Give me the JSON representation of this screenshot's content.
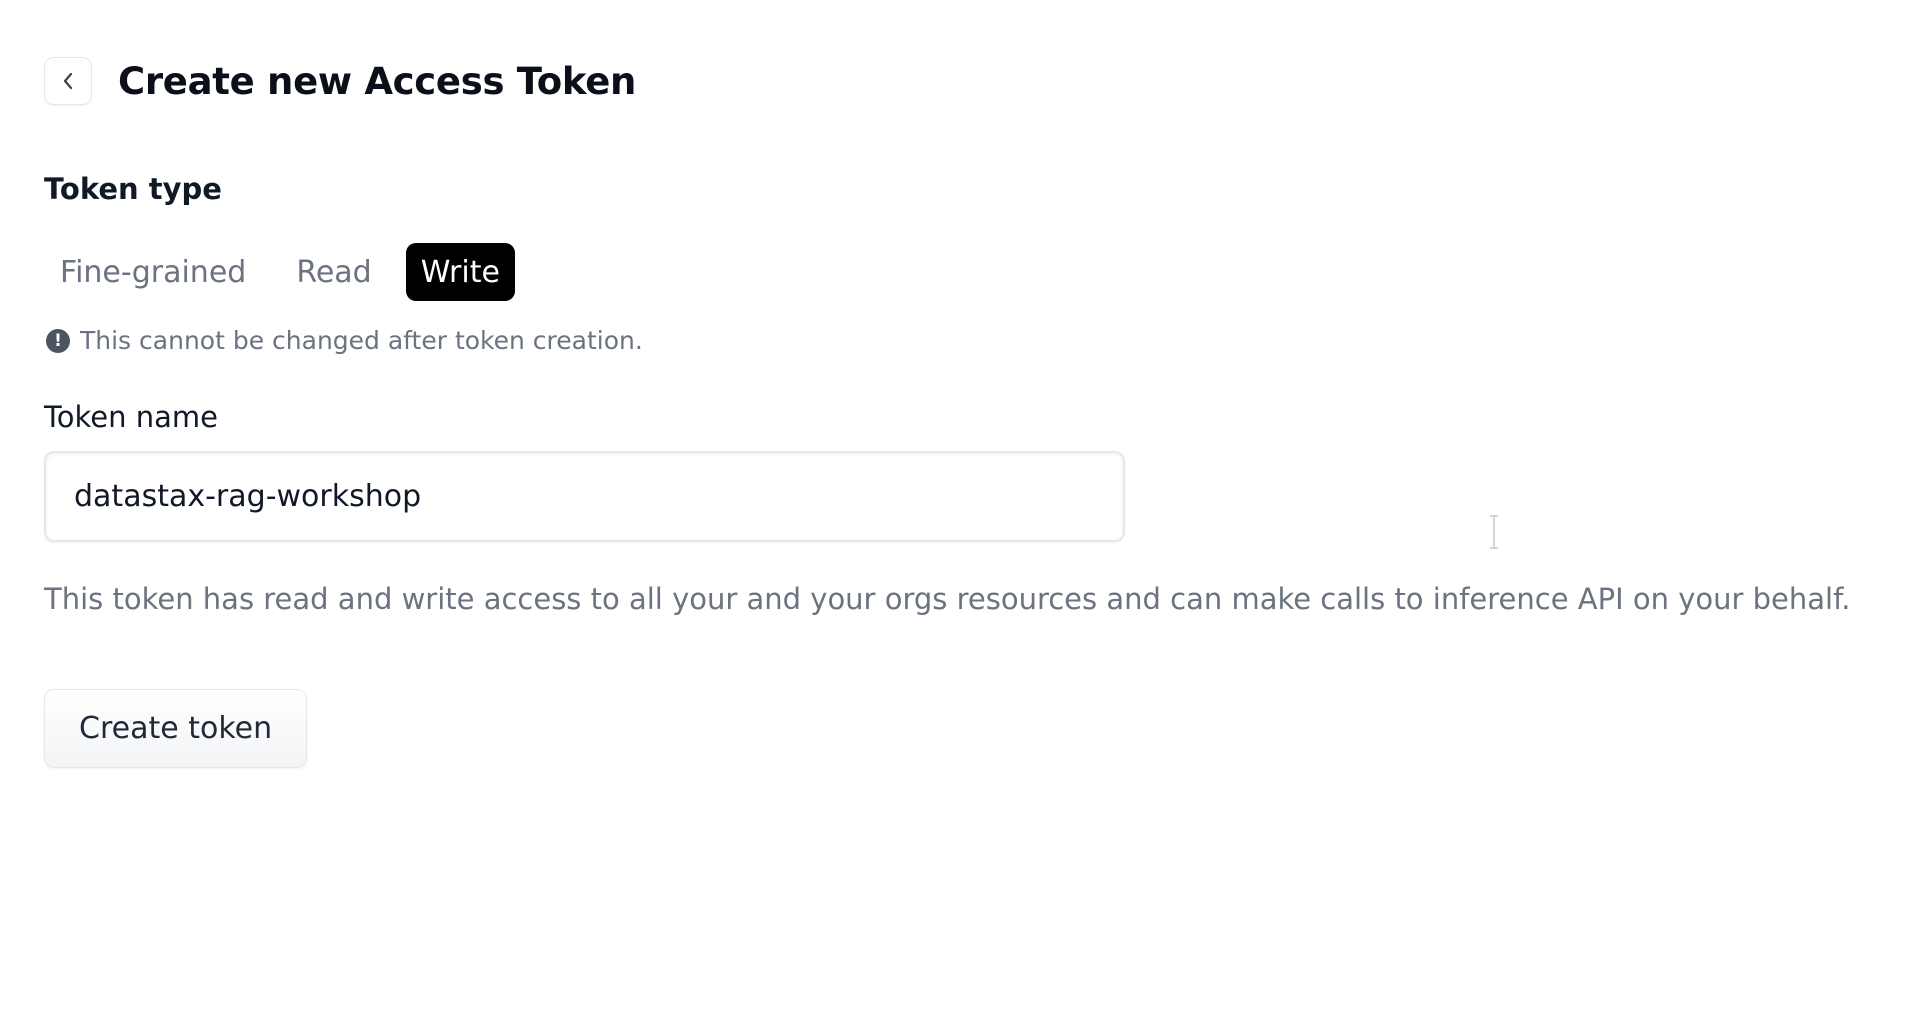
{
  "header": {
    "title": "Create new Access Token",
    "back_icon": "chevron-left-icon"
  },
  "token_type": {
    "label": "Token type",
    "options": [
      {
        "label": "Fine-grained",
        "selected": false
      },
      {
        "label": "Read",
        "selected": false
      },
      {
        "label": "Write",
        "selected": true
      }
    ],
    "notice_icon": "exclamation-circle-icon",
    "notice": "This cannot be changed after token creation."
  },
  "token_name": {
    "label": "Token name",
    "value": "datastax-rag-workshop"
  },
  "description": "This token has read and write access to all your and your orgs resources and can make calls to inference API on your behalf.",
  "actions": {
    "create_label": "Create token"
  },
  "colors": {
    "active_tab_bg": "#000000",
    "active_tab_text": "#ffffff",
    "muted_text": "#6b7280"
  }
}
